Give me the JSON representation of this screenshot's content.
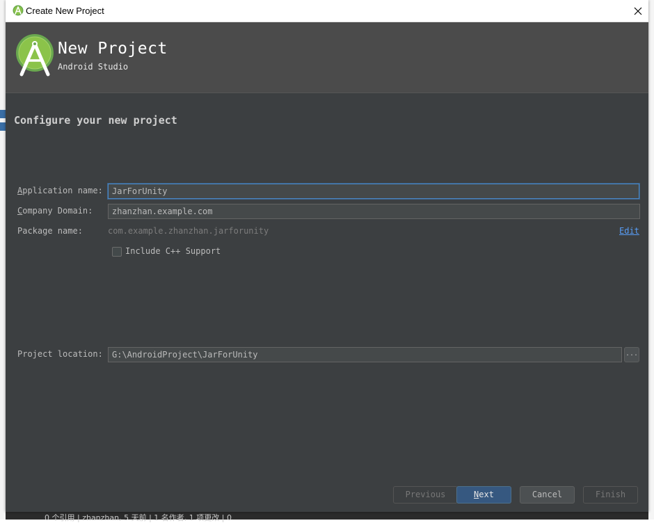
{
  "window": {
    "title": "Create New Project"
  },
  "header": {
    "title": "New Project",
    "subtitle": "Android Studio"
  },
  "section_title": "Configure your new project",
  "form": {
    "application_name": {
      "label_mnemonic": "A",
      "label_rest": "pplication name:",
      "value": "JarForUnity"
    },
    "company_domain": {
      "label_mnemonic": "C",
      "label_rest": "ompany Domain:",
      "value": "zhanzhan.example.com"
    },
    "package_name": {
      "label": "Package name:",
      "value": "com.example.zhanzhan.jarforunity",
      "edit_label": "Edit"
    },
    "cpp_support": {
      "label": "Include C++ Support",
      "checked": false
    },
    "project_location": {
      "label": "Project location:",
      "value": "G:\\AndroidProject\\JarForUnity",
      "browse_label": "..."
    }
  },
  "buttons": {
    "previous": "Previous",
    "next_mnemonic": "N",
    "next_rest": "ext",
    "cancel": "Cancel",
    "finish": "Finish"
  },
  "background": {
    "bottom_text": "0 个引用 | zhanzhan, 5 天前 | 1 名作者, 1 项更改 | 0"
  },
  "colors": {
    "dialog_bg": "#3c3f41",
    "header_bg": "#4b4b4b",
    "accent": "#365880",
    "focus": "#4a88c7",
    "android_green": "#8bc34a"
  }
}
